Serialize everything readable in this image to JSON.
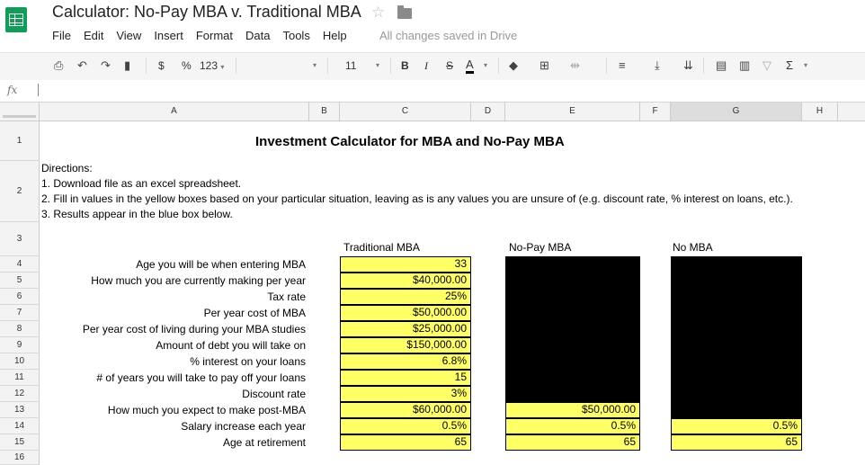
{
  "window": {
    "title": "Calculator: No-Pay MBA v. Traditional MBA",
    "save_status": "All changes saved in Drive"
  },
  "menu": [
    "File",
    "Edit",
    "View",
    "Insert",
    "Format",
    "Data",
    "Tools",
    "Help"
  ],
  "toolbar": {
    "currency": "$",
    "percent": "%",
    "number_format": "123",
    "font_size": "11",
    "bold": "B",
    "italic": "I",
    "strikethrough": "S",
    "text_color": "A",
    "sum": "Σ",
    "icons": [
      "print-icon",
      "undo-icon",
      "redo-icon",
      "paint-format-icon",
      "fill-color-icon",
      "borders-icon",
      "merge-icon",
      "align-icon",
      "valign-icon",
      "wrap-icon",
      "comment-icon",
      "chart-icon",
      "filter-icon",
      "functions-icon"
    ]
  },
  "formula_bar": {
    "fx": "fx",
    "value": ""
  },
  "columns": [
    "A",
    "B",
    "C",
    "D",
    "E",
    "F",
    "G",
    "H"
  ],
  "selected_column": "G",
  "rows": [
    "1",
    "2",
    "3",
    "4",
    "5",
    "6",
    "7",
    "8",
    "9",
    "10",
    "11",
    "12",
    "13",
    "14",
    "15",
    "16"
  ],
  "sheet": {
    "title": "Investment Calculator for MBA and No-Pay MBA",
    "directions": [
      "Directions:",
      "1. Download file as an excel spreadsheet.",
      "2. Fill in values in the yellow boxes based on your particular situation, leaving as is any values you are unsure of (e.g. discount rate, % interest on loans, etc.).",
      "3. Results appear in the blue box below."
    ],
    "headers": {
      "traditional": "Traditional MBA",
      "no_pay": "No-Pay MBA",
      "no_mba": "No MBA"
    },
    "labels": [
      "Age you will be when entering MBA",
      "How much you are currently making per year",
      "Tax rate",
      "Per year cost of MBA",
      "Per year cost of living during your MBA studies",
      "Amount of debt you will take on",
      "% interest on your loans",
      "# of years you will take to pay off your loans",
      "Discount rate",
      "How much you expect to make post-MBA",
      "Salary increase each year",
      "Age at retirement"
    ],
    "traditional_values": [
      "33",
      "$40,000.00",
      "25%",
      "$50,000.00",
      "$25,000.00",
      "$150,000.00",
      "6.8%",
      "15",
      "3%",
      "$60,000.00",
      "0.5%",
      "65"
    ],
    "no_pay_values": [
      "$50,000.00",
      "0.5%",
      "65"
    ],
    "no_mba_values": [
      "0.5%",
      "65"
    ]
  }
}
